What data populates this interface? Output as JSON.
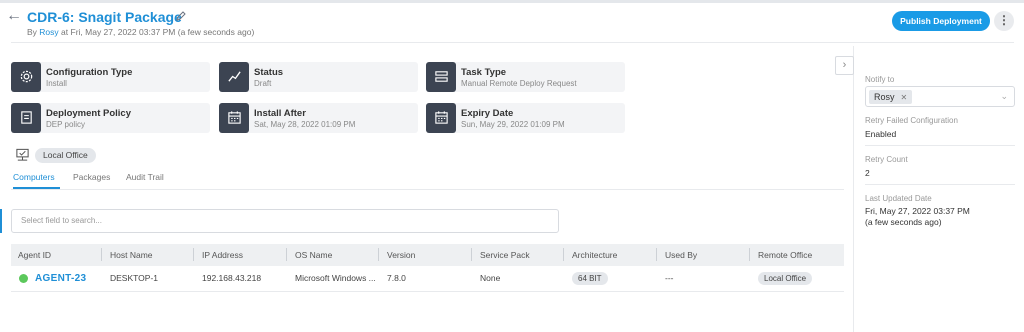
{
  "header": {
    "back_icon": "arrow-left-icon",
    "title": "CDR-6: Snagit Package",
    "edit_icon": "pencil-icon",
    "by_prefix": "By",
    "by_user": "Rosy",
    "by_suffix": "at Fri, May 27, 2022 03:37 PM (a few seconds ago)",
    "publish_label": "Publish Deployment",
    "more_icon": "kebab-menu-icon",
    "more_glyph": "⋮"
  },
  "cards": [
    {
      "icon": "gear-icon",
      "label": "Configuration Type",
      "value": "Install"
    },
    {
      "icon": "chart-line-icon",
      "label": "Status",
      "value": "Draft"
    },
    {
      "icon": "task-list-icon",
      "label": "Task Type",
      "value": "Manual Remote Deploy Request"
    },
    {
      "icon": "document-icon",
      "label": "Deployment Policy",
      "value": "DEP policy"
    },
    {
      "icon": "calendar-icon",
      "label": "Install After",
      "value": "Sat, May 28, 2022 01:09 PM"
    },
    {
      "icon": "calendar-icon",
      "label": "Expiry Date",
      "value": "Sun, May 29, 2022 01:09 PM"
    }
  ],
  "scope": {
    "icon": "network-computer-icon",
    "label": "Local Office"
  },
  "tabs": [
    {
      "label": "Computers",
      "active": true
    },
    {
      "label": "Packages",
      "active": false
    },
    {
      "label": "Audit Trail",
      "active": false
    }
  ],
  "search": {
    "placeholder": "Select field to search..."
  },
  "table": {
    "columns": [
      "Agent ID",
      "Host Name",
      "IP Address",
      "OS Name",
      "Version",
      "Service Pack",
      "Architecture",
      "Used By",
      "Remote Office"
    ],
    "rows": [
      {
        "status_color": "#5cc85c",
        "agent_id": "AGENT-23",
        "host_name": "DESKTOP-1",
        "ip_address": "192.168.43.218",
        "os_name": "Microsoft Windows ...",
        "version": "7.8.0",
        "service_pack": "None",
        "architecture": "64 BIT",
        "used_by": "---",
        "remote_office": "Local Office"
      }
    ]
  },
  "sidebar": {
    "collapse_icon": "chevron-right-icon",
    "notify_label": "Notify to",
    "notify_selected": "Rosy",
    "retry_failed_label": "Retry Failed Configuration",
    "retry_failed_value": "Enabled",
    "retry_count_label": "Retry Count",
    "retry_count_value": "2",
    "last_updated_label": "Last Updated Date",
    "last_updated_value": "Fri, May 27, 2022 03:37 PM",
    "last_updated_relative": "(a few seconds ago)"
  },
  "colors": {
    "accent": "#1f8fd6",
    "publish": "#1a9be6",
    "icon_tile": "#3c4452",
    "online": "#5cc85c"
  }
}
